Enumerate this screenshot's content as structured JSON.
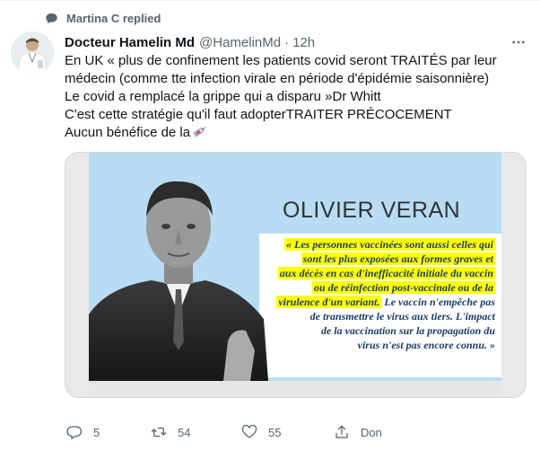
{
  "reply_context": {
    "text": "Martina C replied"
  },
  "author": {
    "display_name": "Docteur Hamelin Md",
    "handle": "@HamelinMd",
    "separator": "·",
    "time": "12h"
  },
  "tweet": {
    "lines": [
      "En UK « plus de confinement les patients covid seront TRAITÉS par leur",
      "médecin (comme tte infection virale en période d'épidémie saisonnière)",
      "Le covid a remplacé la grippe qui a disparu »Dr Whitt",
      "C'est cette stratégie qu'il faut adopterTRAITER PRÉCOCEMENT",
      "Aucun bénéfice de la"
    ],
    "emoji_icon": "syringe-icon"
  },
  "media": {
    "headline": "OLIVIER VERAN",
    "quote_highlighted": [
      "« Les personnes vaccinées sont aussi celles qui",
      "sont les plus exposées aux formes graves et",
      "aux décès en cas d'inefficacité initiale du vaccin",
      "ou de réinfection post-vaccinale ou de la",
      "virulence d'un variant."
    ],
    "quote_tail_same_line": "Le vaccin n'empêche pas",
    "quote_plain": [
      "de transmettre le virus aux tiers. L'impact",
      "de la vaccination sur la propagation du",
      "virus n'est  pas encore connu. »"
    ],
    "colors": {
      "banner": "#b7dcf3",
      "highlight": "#ffff00",
      "quote_text": "#1b3c66"
    }
  },
  "actions": {
    "replies": "5",
    "retweets": "54",
    "likes": "55",
    "share_label": "Don"
  },
  "colors": {
    "secondary_text": "#536471",
    "primary_text": "#0f1419",
    "border": "#cfd9de"
  }
}
